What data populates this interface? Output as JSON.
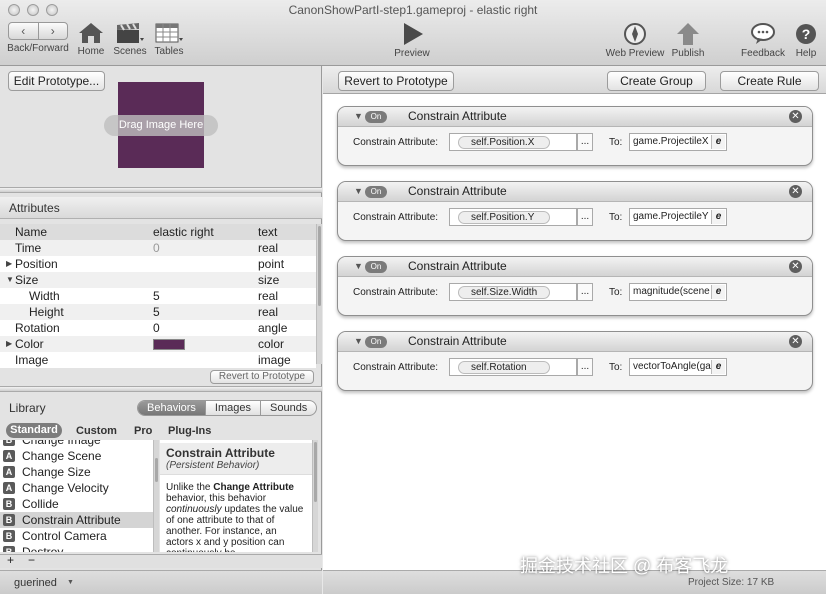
{
  "window": {
    "title": "CanonShowPartI-step1.gameproj - elastic right"
  },
  "toolbar": {
    "back_forward": {
      "label": "Back/Forward",
      "back_glyph": "‹",
      "forward_glyph": "›"
    },
    "home": {
      "label": "Home",
      "icon": "house-icon"
    },
    "scenes": {
      "label": "Scenes",
      "icon": "clapperboard-icon"
    },
    "tables": {
      "label": "Tables",
      "icon": "table-icon"
    },
    "preview": {
      "label": "Preview",
      "icon": "play-icon"
    },
    "web_preview": {
      "label": "Web Preview",
      "icon": "compass-icon"
    },
    "publish": {
      "label": "Publish",
      "icon": "upload-arrow-icon"
    },
    "feedback": {
      "label": "Feedback",
      "icon": "speech-bubble-icon"
    },
    "help": {
      "label": "Help",
      "icon": "question-icon"
    }
  },
  "prototype": {
    "edit_button": "Edit Prototype...",
    "drag_label": "Drag Image Here",
    "image_color": "#5a2b57"
  },
  "attributes": {
    "header": "Attributes",
    "columns": {
      "name": "Name",
      "value": "elastic right",
      "type": "text"
    },
    "rows": [
      {
        "name": "Time",
        "value": "0",
        "type": "real",
        "indent": 0,
        "toggle": "",
        "dim": true
      },
      {
        "name": "Position",
        "value": "",
        "type": "point",
        "indent": 0,
        "toggle": "▶"
      },
      {
        "name": "Size",
        "value": "",
        "type": "size",
        "indent": 0,
        "toggle": "▼"
      },
      {
        "name": "Width",
        "value": "5",
        "type": "real",
        "indent": 1,
        "toggle": ""
      },
      {
        "name": "Height",
        "value": "5",
        "type": "real",
        "indent": 1,
        "toggle": ""
      },
      {
        "name": "Rotation",
        "value": "0",
        "type": "angle",
        "indent": 0,
        "toggle": ""
      },
      {
        "name": "Color",
        "value": "",
        "type": "color",
        "indent": 0,
        "toggle": "▶",
        "swatch": true
      },
      {
        "name": "Image",
        "value": "",
        "type": "image",
        "indent": 0,
        "toggle": ""
      }
    ],
    "revert_button": "Revert to Prototype"
  },
  "library": {
    "header": "Library",
    "tabs": [
      {
        "label": "Behaviors",
        "selected": true
      },
      {
        "label": "Images",
        "selected": false
      },
      {
        "label": "Sounds",
        "selected": false
      }
    ],
    "subtabs": [
      "Standard",
      "Custom",
      "Pro",
      "Plug-Ins"
    ],
    "items": [
      {
        "badge": "B",
        "label": "Change Image",
        "selected": false
      },
      {
        "badge": "A",
        "label": "Change Scene",
        "selected": false
      },
      {
        "badge": "A",
        "label": "Change Size",
        "selected": false
      },
      {
        "badge": "A",
        "label": "Change Velocity",
        "selected": false
      },
      {
        "badge": "B",
        "label": "Collide",
        "selected": false
      },
      {
        "badge": "B",
        "label": "Constrain Attribute",
        "selected": true
      },
      {
        "badge": "B",
        "label": "Control Camera",
        "selected": false
      },
      {
        "badge": "B",
        "label": "Destroy",
        "selected": false
      }
    ],
    "description": {
      "title": "Constrain Attribute",
      "subtitle": "(Persistent Behavior)",
      "body_1": "Unlike the ",
      "body_bold": "Change Attribute",
      "body_2": " behavior, this behavior ",
      "body_italic": "continuously",
      "body_3": " updates the value of one attribute to that of another. For instance, an actors x and y position can continuously be"
    },
    "add_glyph": "+",
    "remove_glyph": "−"
  },
  "footer": {
    "user": "guerined",
    "user_arrow": "▼",
    "project_size": "Project Size: 17 KB"
  },
  "rules_toolbar": {
    "revert_button": "Revert to Prototype",
    "create_group_button": "Create Group",
    "create_rule_button": "Create Rule"
  },
  "rules": [
    {
      "on_label": "On",
      "title": "Constrain Attribute",
      "label1": "Constrain Attribute:",
      "attribute": "self.Position.X",
      "dots": "...",
      "label2": "To:",
      "target": "game.ProjectileX",
      "edit": "e"
    },
    {
      "on_label": "On",
      "title": "Constrain Attribute",
      "label1": "Constrain Attribute:",
      "attribute": "self.Position.Y",
      "dots": "...",
      "label2": "To:",
      "target": "game.ProjectileY",
      "edit": "e"
    },
    {
      "on_label": "On",
      "title": "Constrain Attribute",
      "label1": "Constrain Attribute:",
      "attribute": "self.Size.Width",
      "dots": "...",
      "label2": "To:",
      "target": "magnitude(scene",
      "edit": "e"
    },
    {
      "on_label": "On",
      "title": "Constrain Attribute",
      "label1": "Constrain Attribute:",
      "attribute": "self.Rotation",
      "dots": "...",
      "label2": "To:",
      "target": "vectorToAngle(ga",
      "edit": "e"
    }
  ],
  "watermark": "掘金技术社区 @ 布客飞龙"
}
